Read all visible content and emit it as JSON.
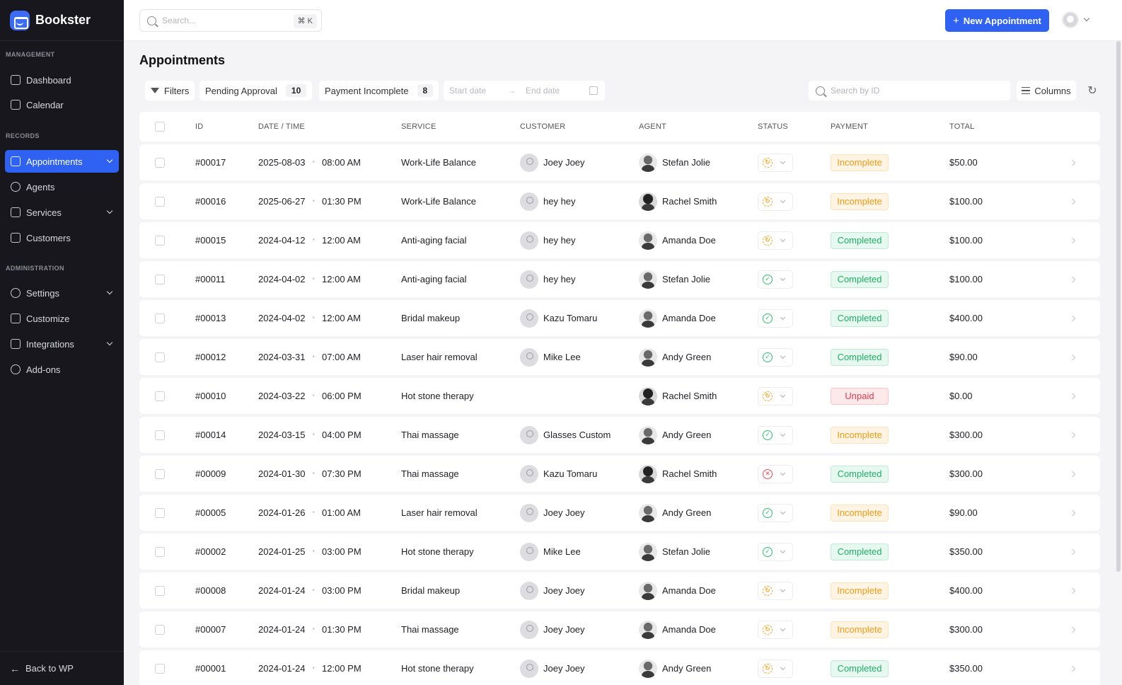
{
  "brand": {
    "name": "Bookster"
  },
  "sidebar": {
    "sections": [
      {
        "title": "Management",
        "items": [
          {
            "label": "Dashboard",
            "icon": "dashboard-icon"
          },
          {
            "label": "Calendar",
            "icon": "calendar-icon"
          }
        ]
      },
      {
        "title": "Records",
        "items": [
          {
            "label": "Appointments",
            "icon": "appointments-icon",
            "active": true,
            "expandable": true
          },
          {
            "label": "Agents",
            "icon": "agents-icon"
          },
          {
            "label": "Services",
            "icon": "services-icon",
            "expandable": true
          },
          {
            "label": "Customers",
            "icon": "customers-icon"
          }
        ]
      },
      {
        "title": "Administration",
        "items": [
          {
            "label": "Settings",
            "icon": "gear-icon",
            "expandable": true
          },
          {
            "label": "Customize",
            "icon": "customize-icon"
          },
          {
            "label": "Integrations",
            "icon": "integrations-icon",
            "expandable": true
          },
          {
            "label": "Add-ons",
            "icon": "plug-icon"
          }
        ]
      }
    ],
    "back_label": "Back to WP"
  },
  "topbar": {
    "search_placeholder": "Search...",
    "shortcut": "⌘ K",
    "new_button": "New Appointment"
  },
  "page": {
    "title": "Appointments",
    "filters_label": "Filters",
    "pending_label": "Pending Approval",
    "pending_count": "10",
    "payment_label": "Payment Incomplete",
    "payment_count": "8",
    "start_date_placeholder": "Start date",
    "end_date_placeholder": "End date",
    "id_search_placeholder": "Search by ID",
    "columns_label": "Columns"
  },
  "table": {
    "headers": {
      "id": "ID",
      "datetime": "Date / Time",
      "service": "Service",
      "customer": "Customer",
      "agent": "Agent",
      "status": "Status",
      "payment": "Payment",
      "total": "Total"
    },
    "rows": [
      {
        "id": "#00017",
        "date": "2025-08-03",
        "time": "08:00 AM",
        "service": "Work-Life Balance",
        "customer": "Joey Joey",
        "agent": "Stefan Jolie",
        "status": "pending",
        "payment": "Incomplete",
        "total": "$50.00"
      },
      {
        "id": "#00016",
        "date": "2025-06-27",
        "time": "01:30 PM",
        "service": "Work-Life Balance",
        "customer": "hey hey",
        "agent": "Rachel Smith",
        "status": "pending",
        "payment": "Incomplete",
        "total": "$100.00"
      },
      {
        "id": "#00015",
        "date": "2024-04-12",
        "time": "12:00 AM",
        "service": "Anti-aging facial",
        "customer": "hey hey",
        "agent": "Amanda Doe",
        "status": "pending",
        "payment": "Completed",
        "total": "$100.00"
      },
      {
        "id": "#00011",
        "date": "2024-04-02",
        "time": "12:00 AM",
        "service": "Anti-aging facial",
        "customer": "hey hey",
        "agent": "Stefan Jolie",
        "status": "approved",
        "payment": "Completed",
        "total": "$100.00"
      },
      {
        "id": "#00013",
        "date": "2024-04-02",
        "time": "12:00 AM",
        "service": "Bridal makeup",
        "customer": "Kazu Tomaru",
        "agent": "Amanda Doe",
        "status": "approved",
        "payment": "Completed",
        "total": "$400.00"
      },
      {
        "id": "#00012",
        "date": "2024-03-31",
        "time": "07:00 AM",
        "service": "Laser hair removal",
        "customer": "Mike Lee",
        "agent": "Andy Green",
        "status": "approved",
        "payment": "Completed",
        "total": "$90.00"
      },
      {
        "id": "#00010",
        "date": "2024-03-22",
        "time": "06:00 PM",
        "service": "Hot stone therapy",
        "customer": "",
        "agent": "Rachel Smith",
        "status": "pending",
        "payment": "Unpaid",
        "total": "$0.00"
      },
      {
        "id": "#00014",
        "date": "2024-03-15",
        "time": "04:00 PM",
        "service": "Thai massage",
        "customer": "Glasses Custom",
        "agent": "Andy Green",
        "status": "approved",
        "payment": "Incomplete",
        "total": "$300.00"
      },
      {
        "id": "#00009",
        "date": "2024-01-30",
        "time": "07:30 PM",
        "service": "Thai massage",
        "customer": "Kazu Tomaru",
        "agent": "Rachel Smith",
        "status": "canceled",
        "payment": "Completed",
        "total": "$300.00"
      },
      {
        "id": "#00005",
        "date": "2024-01-26",
        "time": "01:00 AM",
        "service": "Laser hair removal",
        "customer": "Joey Joey",
        "agent": "Andy Green",
        "status": "approved",
        "payment": "Incomplete",
        "total": "$90.00"
      },
      {
        "id": "#00002",
        "date": "2024-01-25",
        "time": "03:00 PM",
        "service": "Hot stone therapy",
        "customer": "Mike Lee",
        "agent": "Stefan Jolie",
        "status": "approved",
        "payment": "Completed",
        "total": "$350.00"
      },
      {
        "id": "#00008",
        "date": "2024-01-24",
        "time": "03:00 PM",
        "service": "Bridal makeup",
        "customer": "Joey Joey",
        "agent": "Amanda Doe",
        "status": "pending",
        "payment": "Incomplete",
        "total": "$400.00"
      },
      {
        "id": "#00007",
        "date": "2024-01-24",
        "time": "01:30 PM",
        "service": "Thai massage",
        "customer": "Joey Joey",
        "agent": "Amanda Doe",
        "status": "pending",
        "payment": "Incomplete",
        "total": "$300.00"
      },
      {
        "id": "#00001",
        "date": "2024-01-24",
        "time": "12:00 PM",
        "service": "Hot stone therapy",
        "customer": "Joey Joey",
        "agent": "Andy Green",
        "status": "pending",
        "payment": "Completed",
        "total": "$350.00"
      }
    ]
  },
  "colors": {
    "accent": "#2f62f3",
    "sidebar_bg": "#17171d",
    "incomplete": "#f09a15",
    "completed": "#1eaf66",
    "unpaid": "#e23c4c"
  }
}
